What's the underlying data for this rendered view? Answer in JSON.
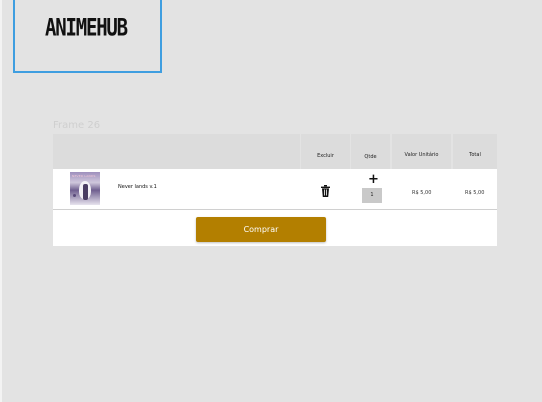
{
  "brand": {
    "logo_text": "ANIMEHUB"
  },
  "frame": {
    "label": "Frame 26"
  },
  "cart": {
    "headers": {
      "excluir": "Excluir",
      "qtde": "Qtde",
      "valor_unitario": "Valor Unitário",
      "total": "Total"
    },
    "item": {
      "name": "Never lands v.1",
      "cover_text": "NEVER LANDS",
      "quantity": "1",
      "unit_price": "R$ 5,00",
      "total": "R$ 5,00"
    },
    "buy_label": "Comprar"
  },
  "colors": {
    "accent": "#b37f00",
    "logo_border": "#3f9ee0",
    "background": "#e3e3e3"
  },
  "icons": {
    "delete": "trash-icon",
    "increase": "plus-icon"
  }
}
